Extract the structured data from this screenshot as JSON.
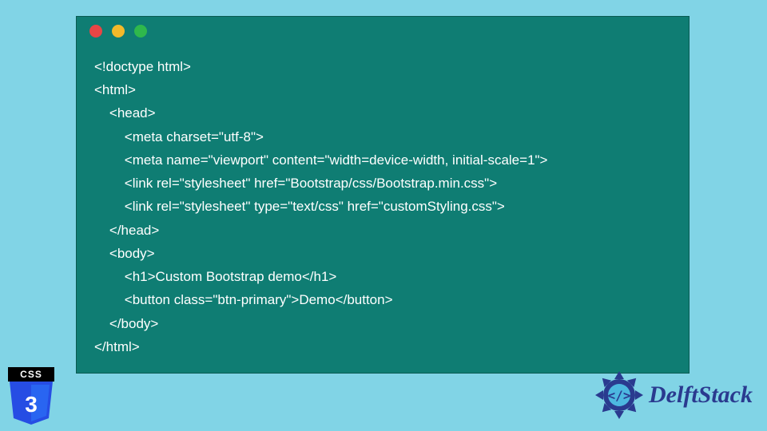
{
  "code": {
    "lines": [
      "<!doctype html>",
      "<html>",
      "    <head>",
      "        <meta charset=\"utf-8\">",
      "        <meta name=\"viewport\" content=\"width=device-width, initial-scale=1\">",
      "        <link rel=\"stylesheet\" href=\"Bootstrap/css/Bootstrap.min.css\">",
      "        <link rel=\"stylesheet\" type=\"text/css\" href=\"customStyling.css\">",
      "    </head>",
      "    <body>",
      "        <h1>Custom Bootstrap demo</h1>",
      "        <button class=\"btn-primary\">Demo</button>",
      "    </body>",
      "</html>"
    ]
  },
  "css3": {
    "label": "CSS",
    "numeral": "3"
  },
  "brand": {
    "name": "DelftStack"
  }
}
